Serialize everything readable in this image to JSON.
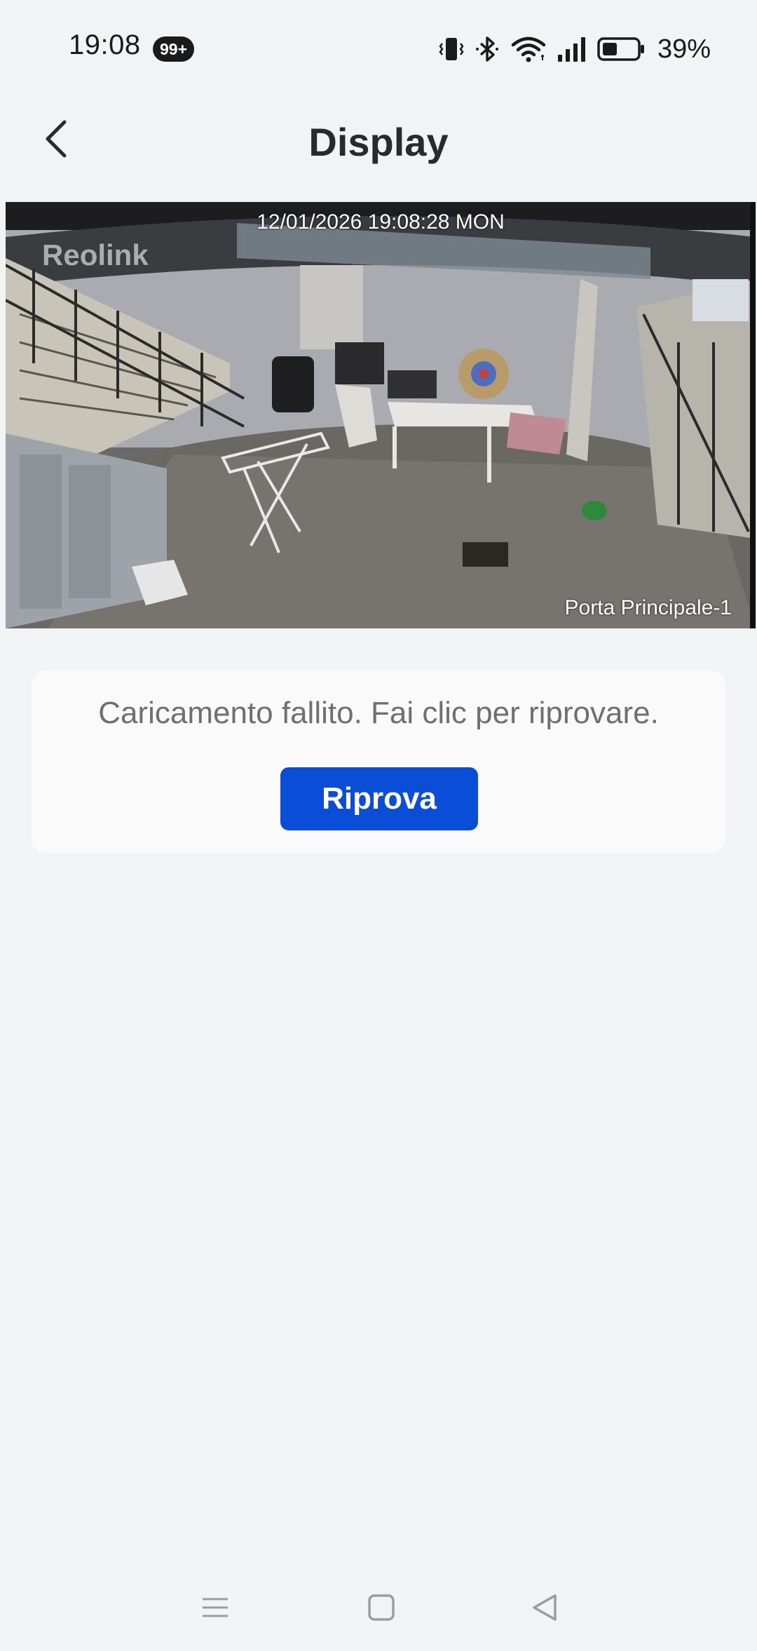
{
  "status_bar": {
    "time": "19:08",
    "notification_badge": "99+",
    "battery_percent": "39%",
    "icons": [
      "vibrate-icon",
      "bluetooth-icon",
      "wifi-icon",
      "signal-icon",
      "battery-icon"
    ]
  },
  "header": {
    "title": "Display",
    "back_icon": "chevron-left-icon"
  },
  "video": {
    "timestamp": "12/01/2026 19:08:28 MON",
    "logo": "Reolink",
    "camera_name": "Porta Principale-1"
  },
  "error_card": {
    "message": "Caricamento fallito. Fai clic per riprovare.",
    "retry_label": "Riprova",
    "retry_color": "#0a4ed8"
  },
  "nav_bar": {
    "icons": [
      "menu-icon",
      "home-icon",
      "back-triangle-icon"
    ]
  }
}
